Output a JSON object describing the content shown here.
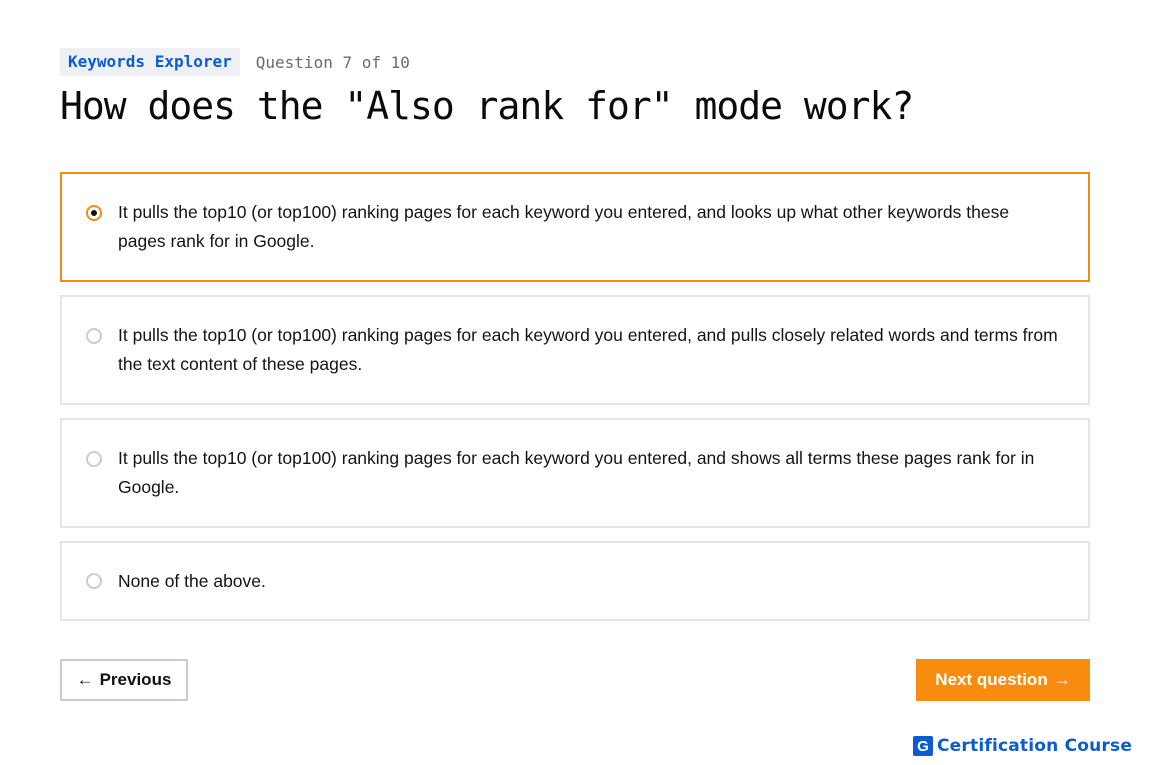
{
  "header": {
    "topic": "Keywords Explorer",
    "progress": "Question 7 of 10"
  },
  "question": {
    "title": "How does the \"Also rank for\" mode work?",
    "selected_index": 0,
    "options": [
      {
        "label": "It pulls the top10 (or top100) ranking pages for each keyword you entered, and looks up what other keywords these pages rank for in Google."
      },
      {
        "label": "It pulls the top10 (or top100) ranking pages for each keyword you entered, and pulls closely related words and terms from the text content of these pages."
      },
      {
        "label": "It pulls the top10 (or top100) ranking pages for each keyword you entered, and shows all terms these pages rank for in Google."
      },
      {
        "label": "None of the above."
      }
    ]
  },
  "navigation": {
    "prev_label": "Previous",
    "prev_arrow": "←",
    "next_label": "Next question",
    "next_arrow": "→"
  },
  "brand": {
    "logo_letter": "G",
    "name": "Certification Course"
  },
  "colors": {
    "accent": "#f78c0f",
    "brand_blue": "#0b5bd3",
    "border": "#e3e5e8"
  }
}
